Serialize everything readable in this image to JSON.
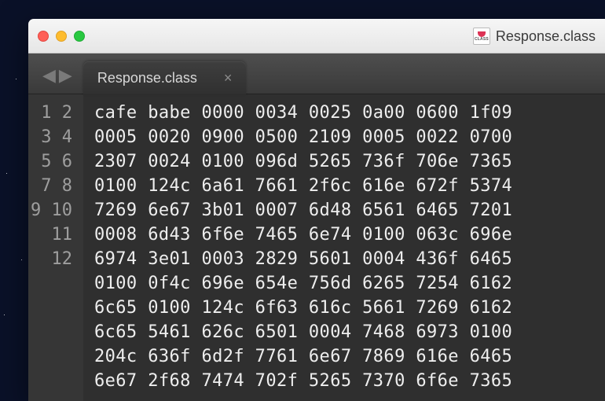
{
  "title": "Response.class",
  "tab": {
    "label": "Response.class",
    "close_glyph": "×"
  },
  "nav": {
    "back": "◀",
    "forward": "▶"
  },
  "lines": [
    "cafe babe 0000 0034 0025 0a00 0600 1f09",
    "0005 0020 0900 0500 2109 0005 0022 0700",
    "2307 0024 0100 096d 5265 736f 706e 7365",
    "0100 124c 6a61 7661 2f6c 616e 672f 5374",
    "7269 6e67 3b01 0007 6d48 6561 6465 7201",
    "0008 6d43 6f6e 7465 6e74 0100 063c 696e",
    "6974 3e01 0003 2829 5601 0004 436f 6465",
    "0100 0f4c 696e 654e 756d 6265 7254 6162",
    "6c65 0100 124c 6f63 616c 5661 7269 6162",
    "6c65 5461 626c 6501 0004 7468 6973 0100",
    "204c 636f 6d2f 7761 6e67 7869 616e 6465",
    "6e67 2f68 7474 702f 5265 7370 6f6e 7365"
  ]
}
